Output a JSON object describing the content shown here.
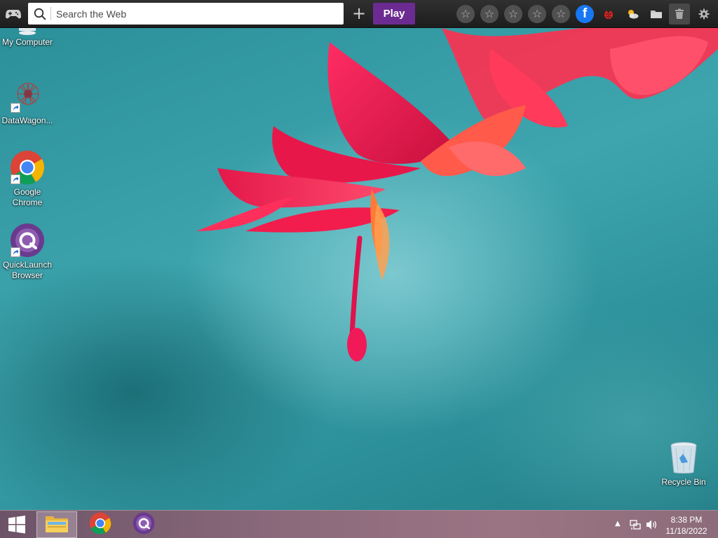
{
  "toolbar": {
    "game_icon": "gamepad-icon",
    "search": {
      "placeholder": "Search the Web",
      "value": ""
    },
    "add_icon": "plus-icon",
    "add_label": "+",
    "play_label": "Play",
    "star_glyph": "☆",
    "favorites": [
      "star-icon",
      "star-icon",
      "star-icon",
      "star-icon",
      "star-icon"
    ],
    "facebook_label": "f",
    "icons": [
      "ladybug-icon",
      "weather-icon",
      "folder-icon",
      "trash-icon",
      "gear-icon"
    ],
    "colors": {
      "play_bg": "#6b2b91",
      "facebook": "#1877f2",
      "bar": "#262626"
    }
  },
  "desktop": {
    "icons": [
      {
        "label": "My Computer",
        "icon": "computer-icon"
      },
      {
        "label": "DataWagon...",
        "icon": "datawagon-icon"
      },
      {
        "label_line1": "Google",
        "label_line2": "Chrome",
        "icon": "chrome-icon"
      },
      {
        "label_line1": "QuickLaunch",
        "label_line2": "Browser",
        "icon": "quicklaunch-icon"
      },
      {
        "label": "Recycle Bin",
        "icon": "recycle-bin-icon"
      }
    ]
  },
  "taskbar": {
    "start_icon": "windows-icon",
    "items": [
      "file-explorer-icon",
      "chrome-icon",
      "quicklaunch-icon"
    ],
    "tray_icons": [
      "chevron-up-icon",
      "network-icon",
      "volume-icon"
    ],
    "tray_up_glyph": "▲",
    "time": "8:38 PM",
    "date": "11/18/2022"
  }
}
